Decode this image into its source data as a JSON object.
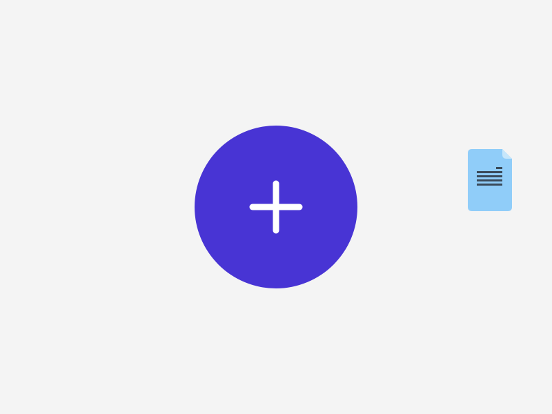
{
  "background_color": "#f4f4f4",
  "add_button": {
    "icon": "plus-icon",
    "color": "#4834d4",
    "icon_color": "#ffffff"
  },
  "document": {
    "icon": "document-icon",
    "body_color": "#90cdf9",
    "fold_color": "#c6e6fb",
    "line_color": "#3a4a5a"
  }
}
